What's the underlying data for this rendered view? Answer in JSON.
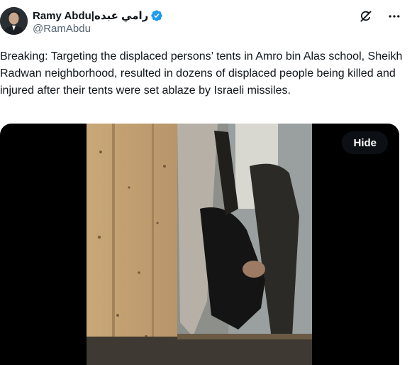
{
  "author": {
    "display_name": "Ramy Abdu|رامي عبده",
    "handle": "@RamAbdu",
    "verified": true
  },
  "post": {
    "text": "Breaking: Targeting the displaced persons’ tents in Amro bin Alas school, Sheikh Radwan neighborhood, resulted in dozens of displaced people being killed and injured after their tents were set ablaze by Israeli missiles."
  },
  "media": {
    "hide_label": "Hide"
  },
  "icons": {
    "grok": "grok-icon",
    "more": "more-icon",
    "verified": "verified-badge-icon"
  },
  "colors": {
    "verified": "#1d9bf0",
    "handle_gray": "#536471",
    "text": "#0f1419"
  }
}
